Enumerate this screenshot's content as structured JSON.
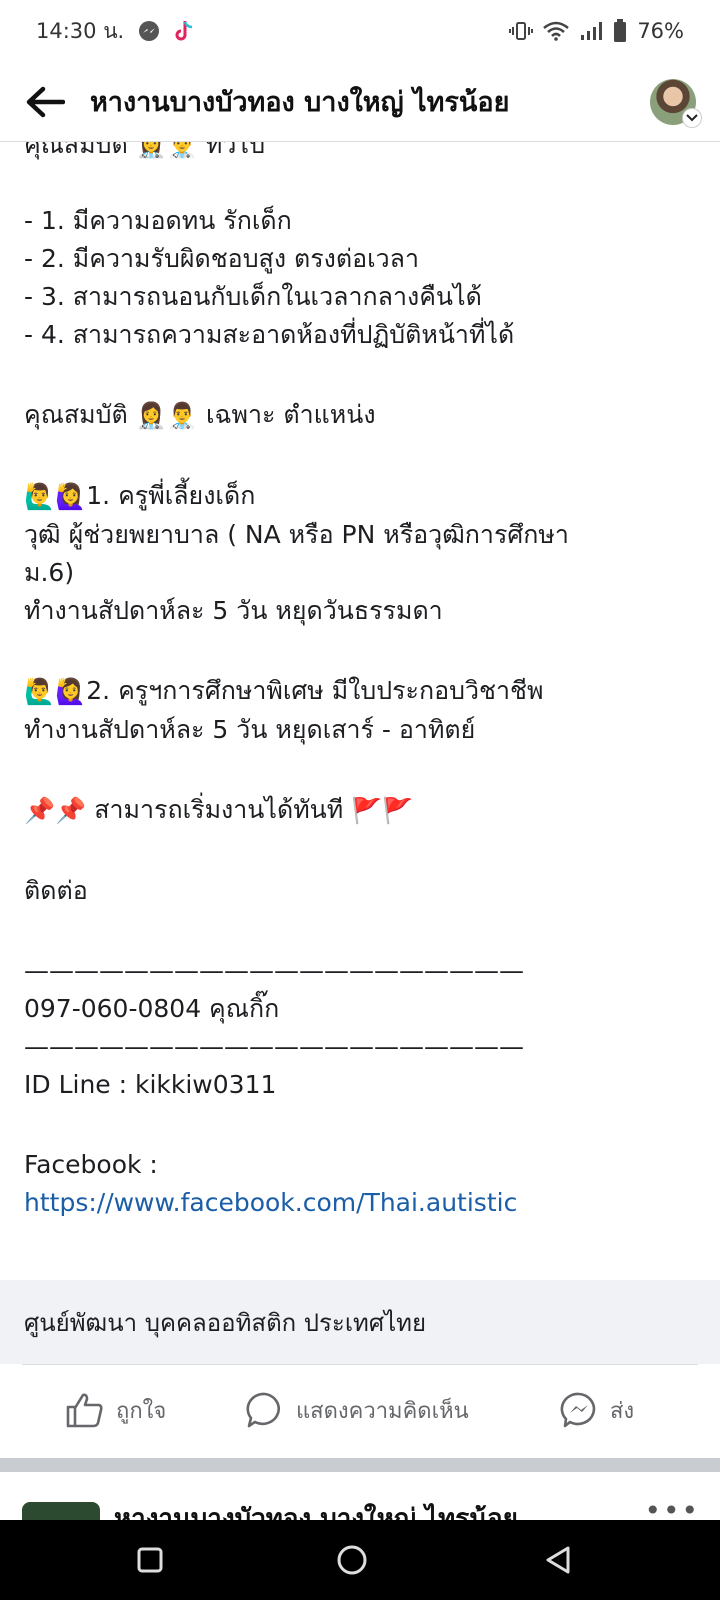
{
  "status_bar": {
    "time": "14:30 น.",
    "battery": "76%"
  },
  "header": {
    "title": "หางานบางบัวทอง  บางใหญ่  ไทรน้อย"
  },
  "post": {
    "cut_top": "คุณสมบัติ 👩‍⚕️👨‍⚕️ ทั่วไป",
    "requirements": [
      "- 1. มีความอดทน รักเด็ก",
      "- 2. มีความรับผิดชอบสูง ตรงต่อเวลา",
      "- 3. สามารถนอนกับเด็กในเวลากลางคืนได้",
      "- 4. สามารถความสะอาดห้องที่ปฏิบัติหน้าที่ได้"
    ],
    "specific_heading_text": "คุณสมบัติ",
    "specific_heading_emoji": "👩‍⚕️👨‍⚕️",
    "specific_heading_tail": "เฉพาะ ตำแหน่ง",
    "job1_emoji": "🙋‍♂️🙋‍♀️",
    "job1_title": "1. ครูพี่เลี้ยงเด็ก",
    "job1_line1": "วุฒิ ผู้ช่วยพยาบาล ( NA หรือ PN หรือวุฒิการศึกษา",
    "job1_line2": "ม.6)",
    "job1_line3": "ทำงานสัปดาห์ละ 5 วัน หยุดวันธรรมดา",
    "job2_emoji": "🙋‍♂️🙋‍♀️",
    "job2_title": "2. ครูฯการศึกษาพิเศษ มีใบประกอบวิชาชีพ",
    "job2_line1": "ทำงานสัปดาห์ละ 5 วัน หยุดเสาร์ - อาทิตย์",
    "start_pins": "📌📌",
    "start_text": "สามารถเริ่มงานได้ทันที",
    "start_flags": "🚩🚩",
    "contact_label": "ติดต่อ",
    "rule": "————————————————————",
    "phone": "097-060-0804 คุณกิ๊ก",
    "line_id": "ID Line : kikkiw0311",
    "facebook_label": "Facebook :",
    "facebook_url": "https://www.facebook.com/Thai.autistic"
  },
  "attachment": {
    "title": "ศูนย์พัฒนา บุคคลออทิสติก ประเทศไทย"
  },
  "actions": {
    "like": "ถูกใจ",
    "comment": "แสดงความคิดเห็น",
    "share": "ส่ง"
  },
  "next_post": {
    "title": "หางานบางบัวทอง  บางใหญ่  ไทรน้อย",
    "more": "•••"
  },
  "colors": {
    "link": "#1a5ea8",
    "attachment_bg": "#f0f2f5",
    "action_text": "#65676b",
    "separator": "#c9ccd1"
  }
}
